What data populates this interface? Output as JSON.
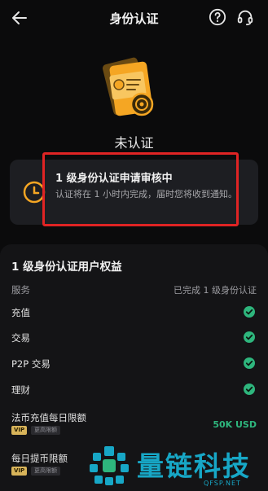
{
  "header": {
    "title": "身份认证",
    "back_icon": "arrow-left-icon",
    "help_icon": "question-circle-icon",
    "support_icon": "headset-icon"
  },
  "status": {
    "illustration": "id-card-badge-icon",
    "text": "未认证"
  },
  "notice": {
    "icon": "clock-icon",
    "title": "1 级身份认证申请审核中",
    "description": "认证将在 1 小时内完成，届时您将收到通知。",
    "highlight_color": "#e02424"
  },
  "benefits": {
    "title": "1 级身份认证用户权益",
    "service_label": "服务",
    "completed_label": "已完成 1 级身份认证",
    "services": [
      {
        "label": "充值"
      },
      {
        "label": "交易"
      },
      {
        "label": "P2P 交易"
      },
      {
        "label": "理财"
      }
    ],
    "deposit_limit": {
      "label": "法币充值每日限额",
      "value": "50K USD",
      "vip": "VIP",
      "vip_more": "更高限额"
    },
    "withdraw_limit": {
      "label": "每日提币限额",
      "vip": "VIP",
      "vip_more": "更高限额"
    }
  },
  "colors": {
    "accent_green": "#2eb67d",
    "gold": "#f5a623",
    "watermark": "#17a7c6"
  },
  "watermark": {
    "text": "量链科技",
    "domain": "QFSP.NET"
  }
}
